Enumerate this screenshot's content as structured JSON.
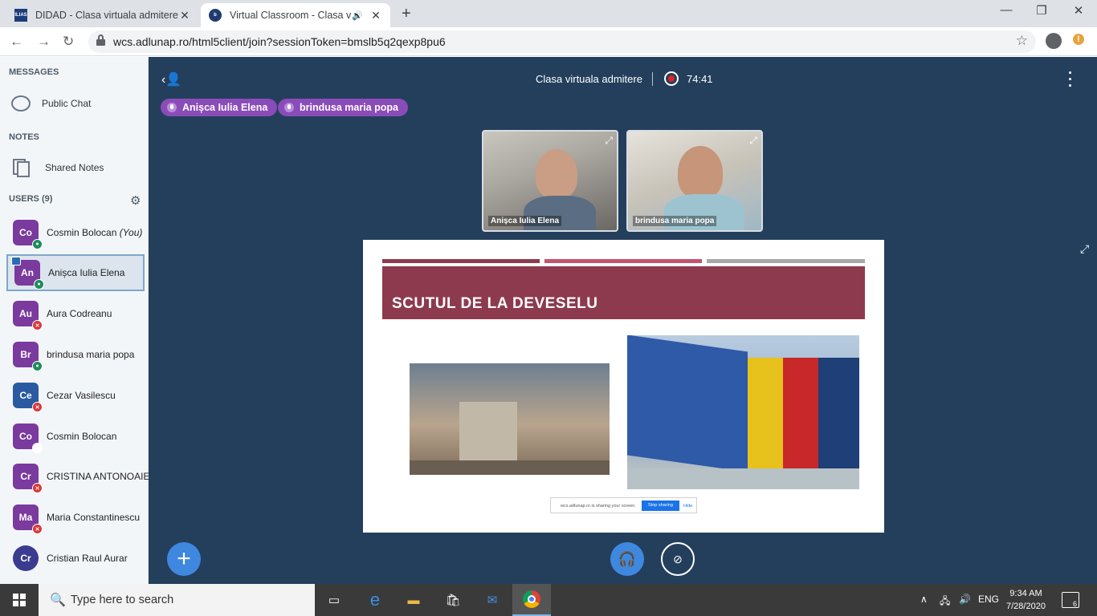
{
  "browser": {
    "tabs": [
      {
        "title": "DIDAD - Clasa virtuala admitere",
        "favicon": "ilias-favicon-icon",
        "favicon_text": "ILIAS"
      },
      {
        "title": "Virtual Classroom - Clasa virt",
        "favicon": "bigbluebutton-favicon-icon",
        "favicon_text": "b"
      }
    ],
    "url": "wcs.adlunap.ro/html5client/join?sessionToken=bmslb5q2qexp8pu6",
    "update_badge": "!"
  },
  "sidebar": {
    "messages_heading": "MESSAGES",
    "public_chat": "Public Chat",
    "notes_heading": "NOTES",
    "shared_notes": "Shared Notes",
    "users_heading": "USERS (9)",
    "you_suffix": "(You)",
    "users": [
      {
        "initials": "Co",
        "name": "Cosmin Bolocan",
        "color": "#7a3a9e",
        "status": "talking",
        "shape": "rounded"
      },
      {
        "initials": "An",
        "name": "Anișca Iulia Elena",
        "color": "#7a3a9e",
        "status": "talking",
        "shape": "rounded",
        "presenter": true
      },
      {
        "initials": "Au",
        "name": "Aura Codreanu",
        "color": "#7a3a9e",
        "status": "muted",
        "shape": "rounded"
      },
      {
        "initials": "Br",
        "name": "brindusa maria popa",
        "color": "#7a3a9e",
        "status": "talking",
        "shape": "rounded"
      },
      {
        "initials": "Ce",
        "name": "Cezar Vasilescu",
        "color": "#2a5ba0",
        "status": "muted",
        "shape": "rounded"
      },
      {
        "initials": "Co",
        "name": "Cosmin Bolocan",
        "color": "#7a3a9e",
        "status": "listen",
        "shape": "rounded"
      },
      {
        "initials": "Cr",
        "name": "CRISTINA ANTONOAIE",
        "color": "#7a3a9e",
        "status": "muted",
        "shape": "rounded"
      },
      {
        "initials": "Ma",
        "name": "Maria Constantinescu",
        "color": "#7a3a9e",
        "status": "muted",
        "shape": "rounded"
      },
      {
        "initials": "Cr",
        "name": "Cristian Raul Aurar",
        "color": "#3b3b8f",
        "status": "none",
        "shape": "round"
      }
    ]
  },
  "main": {
    "session_title": "Clasa virtuala admitere",
    "recording_time": "74:41",
    "talkers": [
      "Anișca Iulia Elena",
      "brindusa maria popa"
    ],
    "videos": [
      {
        "name": "Anișca Iulia Elena"
      },
      {
        "name": "brindusa maria popa"
      }
    ],
    "slide": {
      "title": "SCUTUL DE LA DEVESELU",
      "share_message": "wcs.adlunap.ro is sharing your screen.",
      "stop_sharing": "Stop sharing",
      "hide": "Hide",
      "bar_colors": [
        "#8e3a4e",
        "#c4546f",
        "#a8a8a8"
      ]
    }
  },
  "taskbar": {
    "search_placeholder": "Type here to search",
    "language": "ENG",
    "time": "9:34 AM",
    "date": "7/28/2020",
    "notifications": "6"
  },
  "colors": {
    "main_bg": "#243f5c",
    "talker_pill": "#8a4cb8",
    "accent_blue": "#3f88e0",
    "talking_badge": "#1f8c5e",
    "muted_badge": "#d9383a"
  }
}
